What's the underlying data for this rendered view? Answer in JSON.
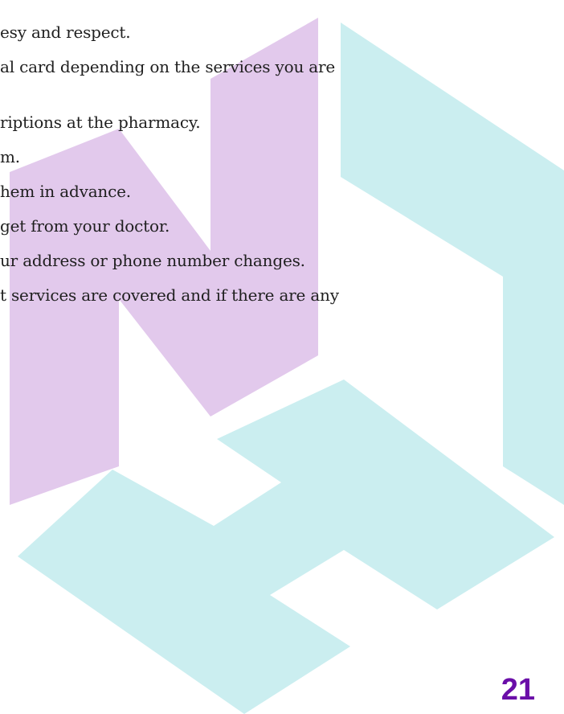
{
  "lines": [
    "esy and respect.",
    "al card depending on the services you are",
    "riptions at the pharmacy.",
    "m.",
    "hem in advance.",
    " get from your doctor.",
    "ur address or phone number changes.",
    "t services are covered and if there are any"
  ],
  "page_number": "21",
  "colors": {
    "watermark_purple": "#e2c9ec",
    "watermark_teal": "#cbeef0",
    "page_number": "#6a0ea8",
    "text": "#1f1f1f"
  }
}
